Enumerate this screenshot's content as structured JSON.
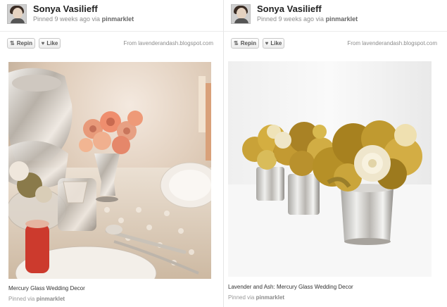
{
  "pins": [
    {
      "user": {
        "name": "Sonya Vasilieff"
      },
      "meta": {
        "prefix": "Pinned 9 weeks ago via ",
        "via": "pinmarklet"
      },
      "actions": {
        "repin_label": "Repin",
        "like_label": "Like"
      },
      "source": "From lavenderandash.blogspot.com",
      "image_alt": "Mercury glass tablescape with coral roses",
      "caption": "Mercury Glass Wedding Decor",
      "pinned_via": {
        "prefix": "Pinned via ",
        "via": "pinmarklet"
      }
    },
    {
      "user": {
        "name": "Sonya Vasilieff"
      },
      "meta": {
        "prefix": "Pinned 9 weeks ago via ",
        "via": "pinmarklet"
      },
      "actions": {
        "repin_label": "Repin",
        "like_label": "Like"
      },
      "source": "From lavenderandash.blogspot.com",
      "image_alt": "Mercury glass votives with yellow felt flowers",
      "caption": "Lavender and Ash: Mercury Glass Wedding Decor",
      "pinned_via": {
        "prefix": "Pinned via ",
        "via": "pinmarklet"
      }
    }
  ],
  "icons": {
    "repin": "repin-icon",
    "like": "heart-icon"
  },
  "colors": {
    "text": "#333333",
    "muted": "#8c8c8c",
    "divider": "#e6e6e6"
  }
}
